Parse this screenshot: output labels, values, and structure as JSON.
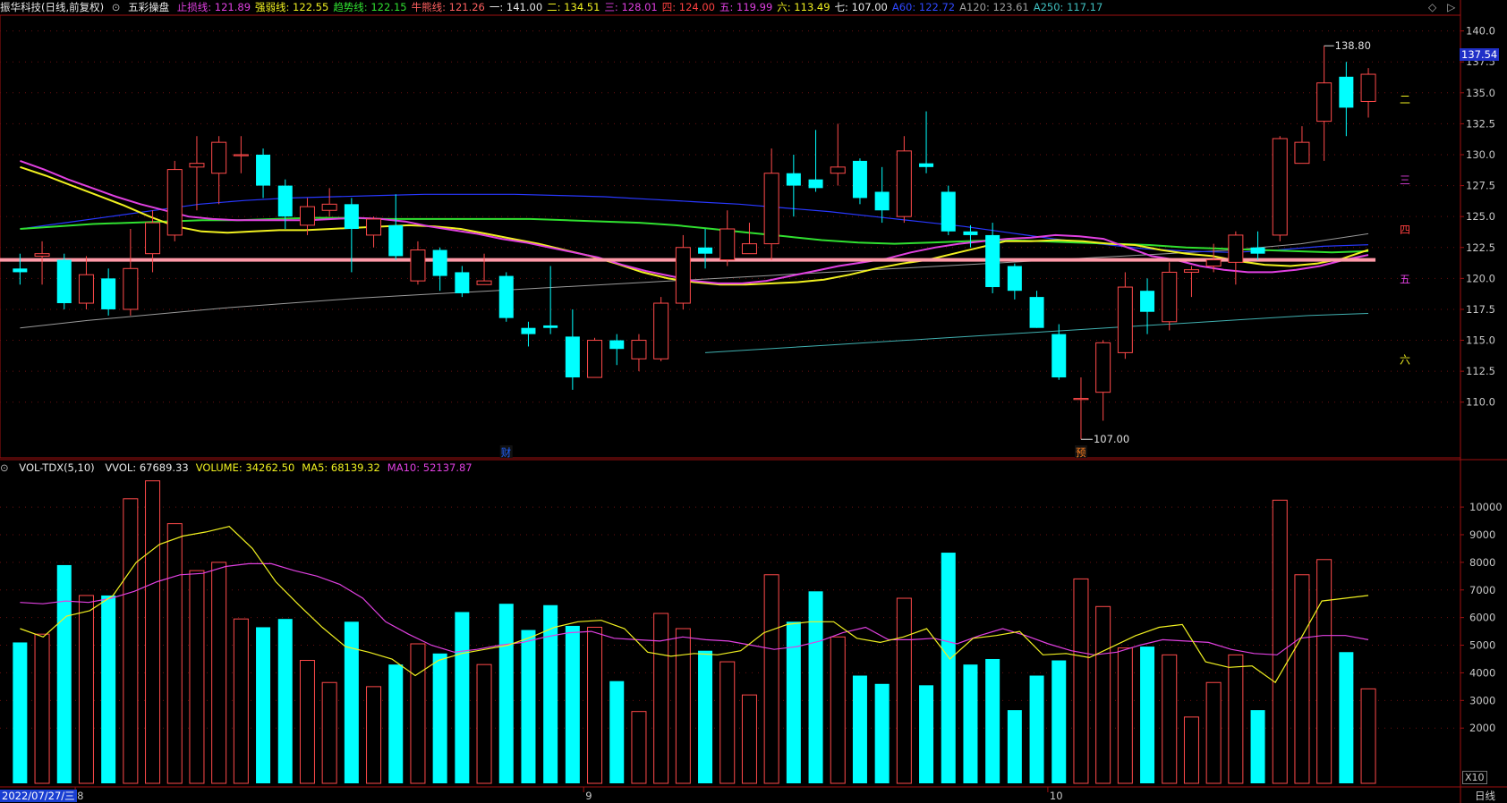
{
  "header": {
    "stock": "振华科技(日线,前复权)",
    "indicator": "五彩操盘",
    "items": [
      {
        "label": "止损线:",
        "value": "121.89",
        "color": "#e040e0"
      },
      {
        "label": "强弱线:",
        "value": "122.55",
        "color": "#f0f020"
      },
      {
        "label": "趋势线:",
        "value": "122.15",
        "color": "#30e030"
      },
      {
        "label": "牛熊线:",
        "value": "121.26",
        "color": "#ff6060"
      },
      {
        "label": "一:",
        "value": "141.00",
        "color": "#e8e8e8"
      },
      {
        "label": "二:",
        "value": "134.51",
        "color": "#f0f020"
      },
      {
        "label": "三:",
        "value": "128.01",
        "color": "#e040e0"
      },
      {
        "label": "四:",
        "value": "124.00",
        "color": "#ff4040"
      },
      {
        "label": "五:",
        "value": "119.99",
        "color": "#e040e0"
      },
      {
        "label": "六:",
        "value": "113.49",
        "color": "#f0f020"
      },
      {
        "label": "七:",
        "value": "107.00",
        "color": "#e8e8e8"
      },
      {
        "label": "A60:",
        "value": "122.72",
        "color": "#3048ff"
      },
      {
        "label": "A120:",
        "value": "123.61",
        "color": "#a0a0a0"
      },
      {
        "label": "A250:",
        "value": "117.17",
        "color": "#40c0c0"
      }
    ]
  },
  "volume_header": {
    "name": "VOL-TDX(5,10)",
    "items": [
      {
        "label": "VVOL:",
        "value": "67689.33",
        "color": "#e8e8e8"
      },
      {
        "label": "VOLUME:",
        "value": "34262.50",
        "color": "#f0f020"
      },
      {
        "label": "MA5:",
        "value": "68139.32",
        "color": "#f0f020"
      },
      {
        "label": "MA10:",
        "value": "52137.87",
        "color": "#e040e0"
      }
    ]
  },
  "price_axis": [
    "140.0",
    "137.5",
    "135.0",
    "132.5",
    "130.0",
    "127.5",
    "125.0",
    "122.5",
    "120.0",
    "117.5",
    "115.0",
    "112.5",
    "110.0"
  ],
  "volume_axis": [
    "10000",
    "9000",
    "8000",
    "7000",
    "6000",
    "5000",
    "4000",
    "3000",
    "2000"
  ],
  "current_price": "137.54",
  "high_label": "138.80",
  "low_label": "107.00",
  "level_labels": [
    {
      "text": "二",
      "price": 134.51,
      "color": "#f0f020"
    },
    {
      "text": "三",
      "price": 128.01,
      "color": "#e040e0"
    },
    {
      "text": "四",
      "price": 124.0,
      "color": "#ff4040"
    },
    {
      "text": "五",
      "price": 119.99,
      "color": "#e040e0"
    },
    {
      "text": "六",
      "price": 113.49,
      "color": "#f0f020"
    }
  ],
  "markers": [
    {
      "text": "财",
      "index": 22,
      "color": "#2060ff"
    },
    {
      "text": "预",
      "index": 48,
      "color": "#ff8020"
    }
  ],
  "x_labels": [
    {
      "text": "8",
      "index": 3
    },
    {
      "text": "9",
      "index": 26
    },
    {
      "text": "10",
      "index": 47
    }
  ],
  "date_label": "2022/07/27/三",
  "period": "日线",
  "x10": "X10",
  "chart_data": {
    "type": "candlestick",
    "candles": [
      [
        120.8,
        120.5,
        122.0,
        119.5,
        5100
      ],
      [
        121.8,
        122.0,
        123.0,
        119.5,
        5400
      ],
      [
        121.5,
        118.0,
        122.0,
        117.5,
        7900
      ],
      [
        118.0,
        120.3,
        121.8,
        117.5,
        6800
      ],
      [
        120.0,
        117.5,
        120.8,
        117.0,
        6800
      ],
      [
        117.5,
        120.8,
        124.0,
        117.0,
        10300
      ],
      [
        122.0,
        124.5,
        125.5,
        120.5,
        10950
      ],
      [
        123.5,
        128.8,
        129.5,
        123.0,
        9400
      ],
      [
        129.0,
        129.3,
        131.5,
        125.5,
        7700
      ],
      [
        128.5,
        131.0,
        131.5,
        126.0,
        8000
      ],
      [
        130.0,
        130.0,
        131.5,
        128.5,
        5950
      ],
      [
        130.0,
        127.5,
        130.5,
        126.5,
        5650
      ],
      [
        127.5,
        125.0,
        128.0,
        124.0,
        5950
      ],
      [
        124.3,
        125.8,
        126.5,
        123.5,
        4450
      ],
      [
        125.5,
        126.0,
        127.3,
        125.0,
        3650
      ],
      [
        126.0,
        124.0,
        126.5,
        120.5,
        5850
      ],
      [
        123.5,
        124.8,
        125.0,
        122.5,
        3500
      ],
      [
        124.3,
        121.8,
        126.8,
        121.5,
        4300
      ],
      [
        119.8,
        122.3,
        123.0,
        119.5,
        5050
      ],
      [
        122.3,
        120.2,
        122.5,
        119.0,
        4700
      ],
      [
        120.5,
        118.8,
        121.0,
        118.5,
        6200
      ],
      [
        119.5,
        119.8,
        122.0,
        119.5,
        4300
      ],
      [
        120.2,
        116.8,
        120.5,
        116.5,
        6500
      ],
      [
        116.0,
        115.5,
        116.5,
        114.5,
        5550
      ],
      [
        116.2,
        116.0,
        121.0,
        115.5,
        6450
      ],
      [
        115.3,
        112.0,
        117.5,
        111.0,
        5700
      ],
      [
        112.0,
        115.0,
        115.2,
        112.0,
        5650
      ],
      [
        115.0,
        114.3,
        115.5,
        113.0,
        3700
      ],
      [
        113.5,
        115.0,
        115.5,
        112.5,
        2600
      ],
      [
        113.5,
        118.0,
        118.5,
        113.3,
        6150
      ],
      [
        118.0,
        122.5,
        123.5,
        117.5,
        5600
      ],
      [
        122.5,
        122.0,
        124.0,
        120.8,
        4800
      ],
      [
        121.5,
        124.0,
        125.5,
        121.0,
        4400
      ],
      [
        122.0,
        122.8,
        124.5,
        122.0,
        3200
      ],
      [
        122.8,
        128.5,
        130.5,
        121.5,
        7550
      ],
      [
        128.5,
        127.5,
        130.0,
        125.0,
        5850
      ],
      [
        128.0,
        127.3,
        132.0,
        127.0,
        6950
      ],
      [
        128.5,
        129.0,
        132.5,
        127.5,
        5300
      ],
      [
        129.5,
        126.5,
        129.7,
        126.0,
        3900
      ],
      [
        127.0,
        125.5,
        129.0,
        124.5,
        3600
      ],
      [
        125.0,
        130.3,
        131.5,
        124.5,
        6700
      ],
      [
        129.3,
        129.0,
        133.5,
        128.5,
        3550
      ],
      [
        127.0,
        123.8,
        127.5,
        123.5,
        8350
      ],
      [
        123.8,
        123.5,
        124.3,
        122.5,
        4300
      ],
      [
        123.5,
        119.3,
        124.5,
        118.8,
        4500
      ],
      [
        121.0,
        119.0,
        121.2,
        118.3,
        2650
      ],
      [
        118.5,
        116.0,
        119.0,
        116.0,
        3900
      ],
      [
        115.5,
        112.0,
        116.3,
        111.8,
        4450
      ],
      [
        110.3,
        110.3,
        112.0,
        107.0,
        7400
      ],
      [
        110.8,
        114.8,
        115.0,
        108.5,
        6400
      ],
      [
        114.0,
        119.3,
        120.5,
        113.5,
        4900
      ],
      [
        119.0,
        117.3,
        120.0,
        115.5,
        4950
      ],
      [
        116.5,
        120.5,
        121.3,
        115.8,
        4650
      ],
      [
        120.5,
        120.7,
        121.0,
        118.5,
        2400
      ],
      [
        121.0,
        121.5,
        122.8,
        120.5,
        3650
      ],
      [
        121.3,
        123.5,
        123.8,
        119.5,
        4650
      ],
      [
        122.5,
        122.0,
        123.8,
        121.5,
        2650
      ],
      [
        123.5,
        131.3,
        131.5,
        123.0,
        10250
      ],
      [
        129.3,
        131.0,
        132.3,
        129.3,
        7550
      ],
      [
        132.7,
        135.8,
        138.8,
        129.5,
        8100
      ],
      [
        136.3,
        133.8,
        137.5,
        131.5,
        4750
      ],
      [
        134.3,
        136.5,
        137.0,
        133.0,
        3420
      ]
    ],
    "candle_fields": [
      "open",
      "close",
      "high",
      "low",
      "volume"
    ],
    "ma_lines": {
      "magenta": [
        129.5,
        128.8,
        128.0,
        127.3,
        126.6,
        126.0,
        125.5,
        125.0,
        124.8,
        124.7,
        124.7,
        124.7,
        124.7,
        124.8,
        124.9,
        124.8,
        124.6,
        124.2,
        123.9,
        123.6,
        123.2,
        122.9,
        122.5,
        122.1,
        121.7,
        121.1,
        120.6,
        120.2,
        119.8,
        119.6,
        119.6,
        119.8,
        120.2,
        120.6,
        121.0,
        121.3,
        121.6,
        122.1,
        122.5,
        122.8,
        123.0,
        123.2,
        123.3,
        123.5,
        123.4,
        123.2,
        122.5,
        121.8,
        121.5,
        121.0,
        120.7,
        120.5,
        120.5,
        120.7,
        121.0,
        121.5,
        121.9
      ],
      "yellow": [
        129.0,
        128.3,
        127.5,
        126.7,
        125.9,
        125.0,
        124.2,
        123.8,
        123.7,
        123.8,
        123.9,
        123.9,
        124.0,
        124.1,
        124.2,
        124.3,
        124.2,
        124.0,
        123.6,
        123.2,
        122.8,
        122.3,
        121.8,
        121.2,
        120.5,
        120.0,
        119.7,
        119.5,
        119.5,
        119.6,
        119.7,
        119.9,
        120.3,
        120.8,
        121.2,
        121.5,
        122.0,
        122.5,
        123.0,
        123.0,
        123.1,
        123.0,
        122.8,
        122.7,
        122.3,
        122.0,
        121.8,
        121.4,
        121.1,
        121.0,
        121.2,
        121.6,
        122.3
      ],
      "green": [
        124.0,
        124.2,
        124.4,
        124.5,
        124.6,
        124.7,
        124.7,
        124.8,
        124.9,
        124.9,
        124.8,
        124.8,
        124.8,
        124.8,
        124.8,
        124.7,
        124.6,
        124.5,
        124.3,
        124.0,
        123.7,
        123.4,
        123.1,
        122.9,
        122.8,
        122.9,
        123.0,
        123.1,
        123.0,
        122.9,
        122.8,
        122.7,
        122.5,
        122.4,
        122.3,
        122.2,
        122.1,
        122.2
      ],
      "blue": [
        124.0,
        124.5,
        125.0,
        125.5,
        126.0,
        126.3,
        126.5,
        126.6,
        126.7,
        126.8,
        126.8,
        126.8,
        126.7,
        126.6,
        126.4,
        126.2,
        126.0,
        125.7,
        125.4,
        125.0,
        124.6,
        124.2,
        123.7,
        123.2,
        122.8,
        122.4,
        122.2,
        122.1,
        122.3,
        122.6,
        122.72
      ],
      "gray": [
        116.0,
        116.6,
        117.1,
        117.6,
        118.0,
        118.4,
        118.7,
        119.0,
        119.3,
        119.6,
        119.9,
        120.2,
        120.5,
        120.8,
        121.1,
        121.4,
        121.7,
        122.0,
        122.3,
        122.8,
        123.61
      ],
      "cyan": [
        114.0,
        114.3,
        114.6,
        114.9,
        115.2,
        115.5,
        115.8,
        116.1,
        116.4,
        116.7,
        117.0,
        117.17
      ],
      "pink_flat": 121.5
    },
    "volume_ma5": [
      5600,
      5300,
      6050,
      6250,
      6800,
      8000,
      8650,
      8950,
      9100,
      9300,
      8500,
      7300,
      6450,
      5650,
      4950,
      4750,
      4500,
      3900,
      4450,
      4700,
      4850,
      5000,
      5300,
      5650,
      5850,
      5900,
      5600,
      4750,
      4600,
      4700,
      4650,
      4800,
      5450,
      5750,
      5850,
      5850,
      5250,
      5100,
      5300,
      5600,
      4500,
      5250,
      5350,
      5500,
      4650,
      4700,
      4550,
      4950,
      5350,
      5650,
      5750,
      4400,
      4200,
      4250,
      3650,
      5100,
      6600,
      6700,
      6800
    ],
    "volume_ma10": [
      6550,
      6500,
      6600,
      6550,
      6700,
      6950,
      7300,
      7550,
      7600,
      7850,
      7950,
      7950,
      7700,
      7500,
      7200,
      6700,
      5850,
      5400,
      5000,
      4750,
      4850,
      5000,
      5100,
      5300,
      5450,
      5500,
      5250,
      5200,
      5150,
      5300,
      5200,
      5150,
      5000,
      4850,
      4950,
      5150,
      5450,
      5650,
      5200,
      5200,
      5250,
      5050,
      5350,
      5600,
      5350,
      5050,
      4800,
      4650,
      4750,
      5000,
      5200,
      5150,
      5100,
      4850,
      4700,
      4650,
      5250,
      5350,
      5350,
      5200
    ]
  }
}
